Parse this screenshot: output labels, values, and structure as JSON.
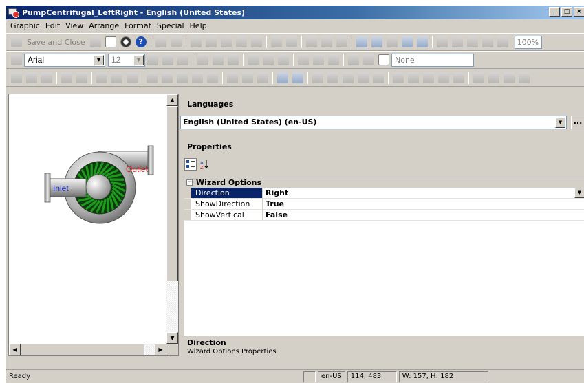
{
  "window": {
    "title": "PumpCentrifugal_LeftRight - English (United States)",
    "minimize_glyph": "_",
    "maximize_glyph": "□",
    "close_glyph": "×"
  },
  "menu": [
    "Graphic",
    "Edit",
    "View",
    "Arrange",
    "Format",
    "Special",
    "Help"
  ],
  "toolbar": {
    "save_and_close": "Save and Close",
    "help_glyph": "?",
    "zoom": "100%",
    "font_name": "Arial",
    "font_size": "12",
    "line_pattern": "None"
  },
  "canvas": {
    "inlet_label": "Inlet",
    "outlet_label": "Outlet"
  },
  "languages": {
    "header": "Languages",
    "selected": "English (United States) (en-US)",
    "ellipsis": "..."
  },
  "properties": {
    "header": "Properties",
    "category": "Wizard Options",
    "expander_glyph": "−",
    "rows": [
      {
        "name": "Direction",
        "value": "Right"
      },
      {
        "name": "ShowDirection",
        "value": "True"
      },
      {
        "name": "ShowVertical",
        "value": "False"
      }
    ],
    "description_title": "Direction",
    "description_text": "Wizard Options Properties"
  },
  "status": {
    "ready": "Ready",
    "culture": "en-US",
    "coords": "114, 483",
    "size": "W: 157, H: 182"
  },
  "colors": {
    "titlebar_start": "#0a246a",
    "titlebar_end": "#a6caf0",
    "selection": "#0a246a",
    "inlet_text": "#1c2fd0",
    "outlet_text": "#c81e1e",
    "impeller": "#1f9a1f"
  }
}
